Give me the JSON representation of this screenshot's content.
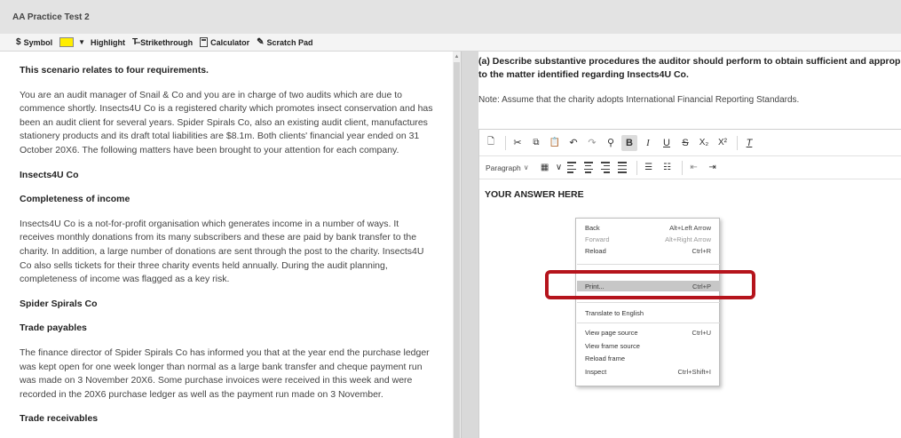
{
  "app": {
    "title": "AA Practice Test 2"
  },
  "toolbar": {
    "symbol_label": "Symbol",
    "highlight_label": "Highlight",
    "highlight_color": "#ffee00",
    "strikethrough_label": "Strikethrough",
    "calculator_label": "Calculator",
    "scratch_pad_label": "Scratch Pad",
    "icons": [
      "dollar-icon",
      "chevron-down-icon",
      "strikethrough-icon",
      "calculator-icon",
      "pencil-icon"
    ]
  },
  "scenario": {
    "intro_heading": "This scenario relates to four requirements.",
    "intro_paragraph": "You are an audit manager of Snail & Co and you are in charge of two audits which are due to commence shortly. Insects4U Co is a registered charity which promotes insect conservation and has been an audit client for several years. Spider Spirals Co, also an existing audit client, manufactures stationery products and its draft total liabilities are $8.1m. Both clients' financial year ended on 31 October 20X6. The following matters have been brought to your attention for each company.",
    "company1_heading": "Insects4U Co",
    "section1_heading": "Completeness of income",
    "section1_paragraph": "Insects4U Co is a not-for-profit organisation which generates income in a number of ways. It receives monthly donations from its many subscribers and these are paid by bank transfer to the charity. In addition, a large number of donations are sent through the post to the charity. Insects4U Co also sells tickets for their three charity events held annually. During the audit planning, completeness of income was flagged as a key risk.",
    "company2_heading": "Spider Spirals Co",
    "section2_heading": "Trade payables",
    "section2_paragraph": "The finance director of Spider Spirals Co has informed you that at the year end the purchase ledger was kept open for one week longer than normal as a large bank transfer and cheque payment run was made on 3 November 20X6. Some purchase invoices were received in this week and were recorded in the 20X6 purchase ledger as well as the payment run made on 3 November.",
    "section3_heading": "Trade receivables"
  },
  "question": {
    "line1": "(a) Describe substantive procedures the auditor should perform to obtain sufficient and appropriate a",
    "line2": "to the matter identified regarding Insects4U Co.",
    "note": "Note: Assume that the charity adopts International Financial Reporting Standards."
  },
  "editor": {
    "paragraph_label": "Paragraph",
    "answer_placeholder": "YOUR ANSWER HERE"
  },
  "context_menu": {
    "items": [
      {
        "label": "Back",
        "shortcut": "Alt+Left Arrow",
        "disabled": false
      },
      {
        "label": "Forward",
        "shortcut": "Alt+Right Arrow",
        "disabled": true
      },
      {
        "label": "Reload",
        "shortcut": "Ctrl+R",
        "disabled": false
      },
      {
        "label": "Print...",
        "shortcut": "Ctrl+P",
        "disabled": false,
        "highlighted": true
      },
      {
        "label": "Translate to English",
        "shortcut": "",
        "disabled": false
      },
      {
        "label": "View page source",
        "shortcut": "Ctrl+U",
        "disabled": false
      },
      {
        "label": "View frame source",
        "shortcut": "",
        "disabled": false
      },
      {
        "label": "Reload frame",
        "shortcut": "",
        "disabled": false
      },
      {
        "label": "Inspect",
        "shortcut": "Ctrl+Shift+I",
        "disabled": false
      }
    ]
  },
  "annotation": {
    "color": "#b5141c"
  }
}
